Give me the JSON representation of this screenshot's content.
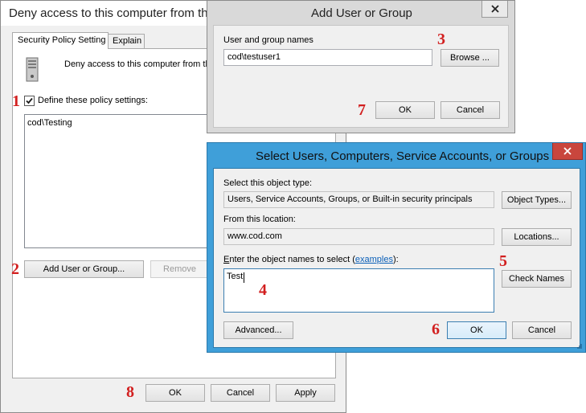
{
  "main_window": {
    "title": "Deny access to this computer from th",
    "tabs": [
      "Security Policy Setting",
      "Explain"
    ],
    "policy_name": "Deny access to this computer from the",
    "define_checkbox_label": "Define these policy settings:",
    "define_checked": true,
    "accounts": [
      "cod\\Testing"
    ],
    "add_button": "Add User or Group...",
    "remove_button": "Remove",
    "ok": "OK",
    "cancel": "Cancel",
    "apply": "Apply"
  },
  "add_dialog": {
    "title": "Add User or Group",
    "names_label": "User and group names",
    "names_value": "cod\\testuser1",
    "browse": "Browse ...",
    "ok": "OK",
    "cancel": "Cancel"
  },
  "select_dialog": {
    "title": "Select Users, Computers, Service Accounts, or Groups",
    "object_type_label": "Select this object type:",
    "object_type_value": "Users, Service Accounts, Groups, or Built-in security principals",
    "object_types_button": "Object Types...",
    "location_label": "From this location:",
    "location_value": "www.cod.com",
    "locations_button": "Locations...",
    "enter_label_prefix": "nter the object names to select (",
    "enter_label_accel": "E",
    "examples_link": "examples",
    "enter_label_suffix": "):",
    "enter_value": "Test",
    "check_names": "Check Names",
    "advanced": "Advanced...",
    "ok": "OK",
    "cancel": "Cancel"
  },
  "step_markers": {
    "s1": "1",
    "s2": "2",
    "s3": "3",
    "s4": "4",
    "s5": "5",
    "s6": "6",
    "s7": "7",
    "s8": "8"
  },
  "colors": {
    "step_red": "#d21f1f",
    "aero_blue": "#3f9fd9",
    "close_red": "#c9463d",
    "link_blue": "#0a5fb8"
  }
}
